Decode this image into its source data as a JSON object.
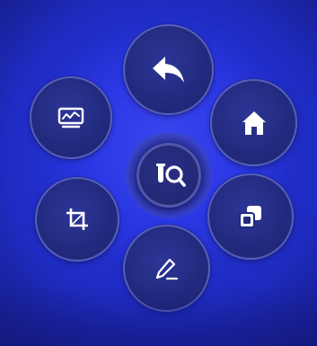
{
  "menu": {
    "buttons": [
      {
        "id": "back",
        "icon": "back-arrow-icon"
      },
      {
        "id": "home",
        "icon": "home-icon"
      },
      {
        "id": "chart",
        "icon": "line-chart-icon"
      },
      {
        "id": "crop",
        "icon": "crop-icon"
      },
      {
        "id": "layers",
        "icon": "layers-icon"
      },
      {
        "id": "edit",
        "icon": "pencil-icon"
      },
      {
        "id": "center",
        "icon": "probe-search-icon"
      }
    ]
  },
  "colors": {
    "background": "#2634d8",
    "button_fill": "#222a7e",
    "button_border": "#969fff",
    "icon": "#ffffff"
  }
}
